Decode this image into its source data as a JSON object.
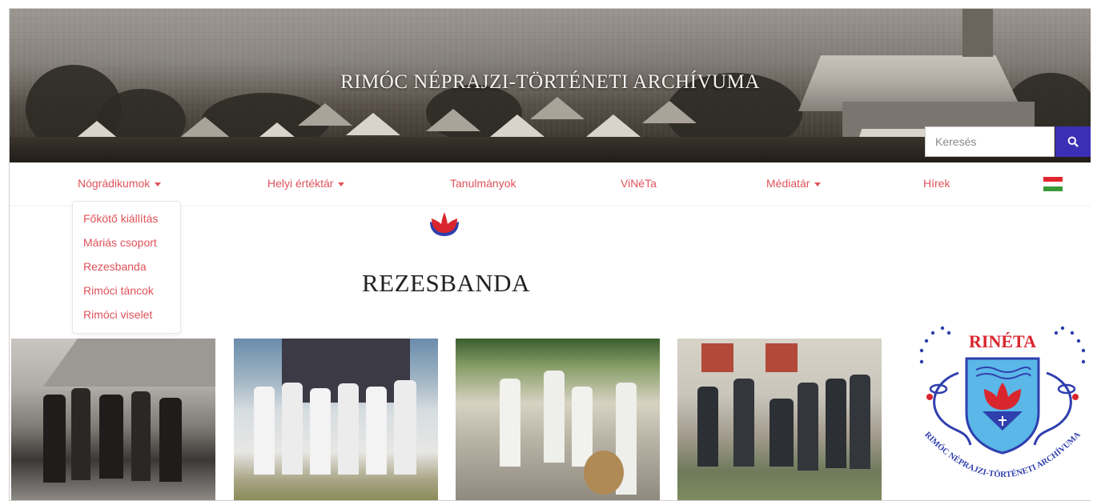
{
  "header": {
    "title": "RIMÓC NÉPRAJZI-TÖRTÉNETI ARCHÍVUMA",
    "search_placeholder": "Keresés",
    "search_icon": "search-icon"
  },
  "nav": {
    "items": [
      {
        "label": "Nógrádikumok",
        "dropdown": true
      },
      {
        "label": "Helyi értéktár",
        "dropdown": true
      },
      {
        "label": "Tanulmányok",
        "dropdown": false
      },
      {
        "label": "ViNéTa",
        "dropdown": false
      },
      {
        "label": "Médiatár",
        "dropdown": true
      },
      {
        "label": "Hírek",
        "dropdown": false
      }
    ],
    "language_flag": "hungarian-flag-icon"
  },
  "dropdown": {
    "items": [
      "Főkötő kiállítás",
      "Máriás csoport",
      "Rezesbanda",
      "Rimóci táncok",
      "Rimóci viselet"
    ]
  },
  "page": {
    "title": "REZESBANDA"
  },
  "logo": {
    "name": "RINÉTA",
    "subtitle": "RIMÓC NÉPRAJZI-TÖRTÉNETI ARCHÍVUMA"
  },
  "colors": {
    "accent": "#e0525a",
    "search_button": "#3b2fb6",
    "logo_blue": "#2f3fae",
    "logo_red": "#d9262e",
    "logo_cyan": "#5ab7e8"
  }
}
